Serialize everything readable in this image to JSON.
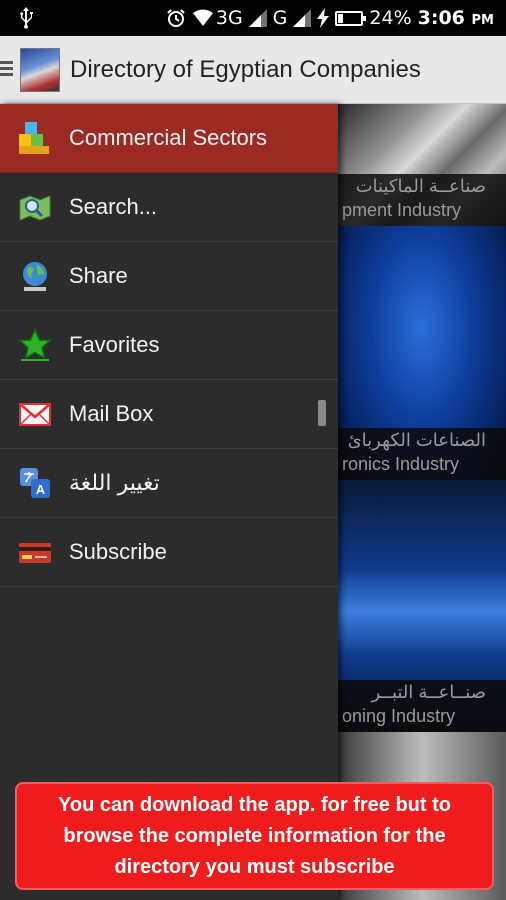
{
  "status_bar": {
    "network_3g": "3G",
    "network_g": "G",
    "battery": "24%",
    "battery_level": 0.24,
    "time": "3:06",
    "ampm": "PM"
  },
  "app_bar": {
    "title": "Directory of Egyptian Companies"
  },
  "drawer": {
    "items": [
      {
        "label": "Commercial Sectors",
        "icon": "sectors-blocks-icon",
        "active": true
      },
      {
        "label": "Search...",
        "icon": "map-search-icon",
        "active": false
      },
      {
        "label": "Share",
        "icon": "globe-share-icon",
        "active": false
      },
      {
        "label": "Favorites",
        "icon": "star-icon",
        "active": false
      },
      {
        "label": "Mail Box",
        "icon": "envelope-icon",
        "active": false
      },
      {
        "label": "تغيير اللغة",
        "icon": "translate-icon",
        "active": false
      },
      {
        "label": "Subscribe",
        "icon": "credit-card-icon",
        "active": false
      }
    ]
  },
  "background_tiles": [
    {
      "ar": "صناعــة الماكينات",
      "en": "pment Industry"
    },
    {
      "ar": "الصناعات الكهربائ",
      "en": "ronics Industry"
    },
    {
      "ar": "صنــاعــة التبــر",
      "en": "oning Industry"
    }
  ],
  "banner": {
    "text": "You can download the app. for free but to browse the complete information for the directory you must subscribe"
  },
  "colors": {
    "drawer_bg": "#2c2c2c",
    "active_item": "#9b2a22",
    "banner_bg": "#ee1c1c",
    "app_bar_bg": "#e8e8e8"
  }
}
